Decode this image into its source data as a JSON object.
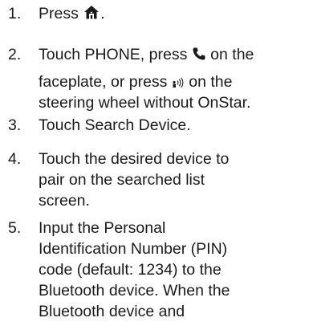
{
  "steps": [
    {
      "number": "1.",
      "line1_before": "Press",
      "line1_after": ".",
      "icon": "home-icon"
    },
    {
      "number": "2.",
      "line1_before": "Touch PHONE, press",
      "line1_after": "on the",
      "line2": "faceplate, or press",
      "line2_after": "on the",
      "line3": "steering wheel without OnStar.",
      "icons": [
        "phone-icon",
        "voice-recognition-icon"
      ]
    },
    {
      "number": "3.",
      "lines": [
        "Touch Search Device."
      ]
    },
    {
      "number": "4.",
      "lines": [
        "Touch the desired device to",
        "pair on the searched list",
        "screen."
      ]
    },
    {
      "number": "5.",
      "lines": [
        "Input the Personal",
        "Identification Number (PIN)",
        "code (default: 1234) to the",
        "Bluetooth device. When the",
        "Bluetooth device and"
      ]
    }
  ]
}
